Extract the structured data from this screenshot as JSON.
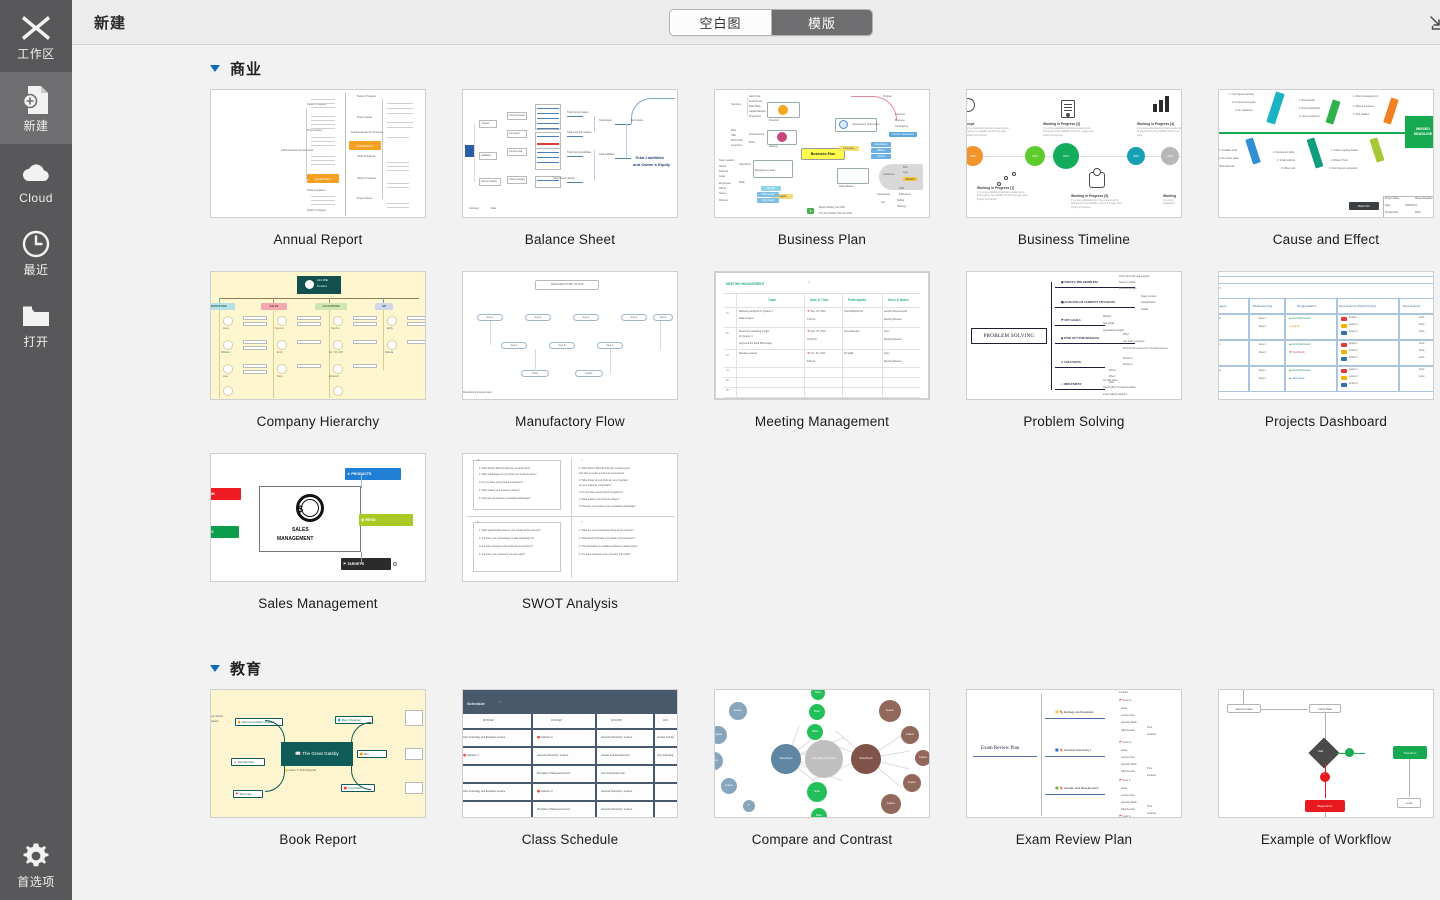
{
  "sidebar": {
    "items": [
      {
        "label": "工作区",
        "icon": "workspace-icon",
        "active": false
      },
      {
        "label": "新建",
        "icon": "new-document-icon",
        "active": true
      },
      {
        "label": "Cloud",
        "icon": "cloud-icon",
        "active": false
      },
      {
        "label": "最近",
        "icon": "clock-icon",
        "active": false
      },
      {
        "label": "打开",
        "icon": "folder-icon",
        "active": false
      }
    ],
    "bottom": {
      "label": "首选项",
      "icon": "gear-icon"
    },
    "background": "#58585a",
    "active_background": "#6e6e70"
  },
  "header": {
    "title": "新建",
    "segmented": {
      "options": [
        {
          "label": "空白图",
          "selected": false
        },
        {
          "label": "模版",
          "selected": true
        }
      ]
    },
    "import_icon": "import-download-icon"
  },
  "sections": [
    {
      "title": "商业",
      "expanded": true,
      "templates": [
        {
          "name": "Annual Report",
          "thumb": "annual-report"
        },
        {
          "name": "Balance Sheet",
          "thumb": "balance-sheet"
        },
        {
          "name": "Business Plan",
          "thumb": "business-plan"
        },
        {
          "name": "Business Timeline",
          "thumb": "business-timeline"
        },
        {
          "name": "Cause and Effect",
          "thumb": "cause-and-effect"
        },
        {
          "name": "Company Hierarchy",
          "thumb": "company-hierarchy"
        },
        {
          "name": "Manufactory Flow",
          "thumb": "manufactory-flow"
        },
        {
          "name": "Meeting Management",
          "thumb": "meeting-management"
        },
        {
          "name": "Problem Solving",
          "thumb": "problem-solving"
        },
        {
          "name": "Projects Dashboard",
          "thumb": "projects-dashboard"
        },
        {
          "name": "Sales Management",
          "thumb": "sales-management"
        },
        {
          "name": "SWOT Analysis",
          "thumb": "swot-analysis"
        }
      ]
    },
    {
      "title": "教育",
      "expanded": true,
      "templates": [
        {
          "name": "Book Report",
          "thumb": "book-report"
        },
        {
          "name": "Class Schedule",
          "thumb": "class-schedule"
        },
        {
          "name": "Compare and Contrast",
          "thumb": "compare-and-contrast"
        },
        {
          "name": "Exam Review Plan",
          "thumb": "exam-review-plan"
        },
        {
          "name": "Example of Workflow",
          "thumb": "example-of-workflow"
        }
      ]
    }
  ],
  "thumbnails": {
    "annual_report": {
      "badges": [
        "QUARTER 2",
        "QUARTER 1"
      ],
      "groups": [
        "Tasks in Progress",
        "Project Issues",
        "Self Assessment & Comments",
        "Tasks Completed"
      ],
      "accent": "#f5a020"
    },
    "balance_sheet": {
      "root": "",
      "branches": [
        "Assets",
        "Liabilities",
        "Owner's Equity"
      ],
      "leaves": [
        "Total Current Assets",
        "Total Long-term Assets",
        "Total Current Liabilities",
        "Total Assets",
        "Total Liabilities",
        "Total Owner's Equity"
      ],
      "callout": "Total Liabilities and Owner's Equity",
      "accent": "#2a5fa8"
    },
    "business_plan": {
      "center": "Business Plan",
      "nodes": [
        "Financial",
        "Strategy",
        "Management Team",
        "Product",
        "Executive Summary",
        "Company",
        "Target Market"
      ],
      "center_fill": "#ffff4d"
    },
    "business_timeline": {
      "milestones": [
        {
          "year": "2012",
          "color": "#f0952a",
          "title": "Concept"
        },
        {
          "year": "2013",
          "color": "#5ecc2b",
          "title": "Working in Progress [1]"
        },
        {
          "year": "2014",
          "color": "#13ab5c",
          "title": "Working in Progress [2]"
        },
        {
          "year": "2015",
          "color": "#18a0b4",
          "title": "Working in Progress [3]"
        },
        {
          "year": "2016",
          "color": "#b7b7b7",
          "title": "Working in Progress [4]"
        }
      ],
      "body": "It is a long established fact that a reader will be distracted by the readable content of a page when looking at its layout."
    },
    "cause_and_effect": {
      "head": "MISSED DEADLINE",
      "bones": [
        {
          "label": "Machine",
          "color": "#19b3c4"
        },
        {
          "label": "Method",
          "color": "#2fb24c"
        },
        {
          "label": "Material",
          "color": "#f38020"
        },
        {
          "label": "Measurement",
          "color": "#2e8fd4"
        },
        {
          "label": "Manpower",
          "color": "#0e9e7e"
        },
        {
          "label": "Mother Nature",
          "color": "#a6c832"
        }
      ],
      "footer_button": "Basic Info",
      "footer_fields": [
        "Project Name",
        "Date",
        "Prepared By"
      ],
      "footer_values": [
        "Missed Deadline",
        "2018/09/19",
        "Molly"
      ],
      "spine_color": "#16a94f"
    },
    "company_hierarchy": {
      "ceo": {
        "name": "John DOE",
        "role": "President"
      },
      "departments": [
        {
          "label": "MARKETING",
          "color": "#b6e2e6"
        },
        {
          "label": "SALES",
          "color": "#f4a9b0"
        },
        {
          "label": "ACCOUNTING",
          "color": "#cfe6b0"
        },
        {
          "label": "HR",
          "color": "#cfd8e8"
        }
      ],
      "background": "#fdf6cf"
    },
    "manufactory_flow": {
      "title": "MANUFACTORY FLOW"
    },
    "meeting_management": {
      "title": "MEETING MANAGEMENT",
      "columns": [
        "",
        "Topic",
        "Date & Time",
        "Participants",
        "Docs & Notes"
      ],
      "rows": [
        {
          "no": "01",
          "topic": "Marketing analysis for Quarter 3 / Data Analysis",
          "date": "Sep. 15, 2018",
          "time": "3:00 pm",
          "participants": "Owen/Molly/Anna",
          "notes": "sample document.pdf / Meeting Minutes"
        },
        {
          "no": "02",
          "topic": "Determine  marketing budget for Quarter 4 / Approved the $100,000 budget",
          "date": "Sep. 30, 2018",
          "time": "10:00 am",
          "participants": "Owen/Stephen",
          "notes": "Docs / Meeting Minutes"
        },
        {
          "no": "03",
          "topic": "Release meeting",
          "date": "Oct. 30, 2018",
          "time": "9:00 am",
          "participants": "All Staffs",
          "notes": "Docs / Meeting Minutes"
        },
        {
          "no": "04",
          "topic": "",
          "date": "",
          "time": "",
          "participants": "",
          "notes": ""
        },
        {
          "no": "05",
          "topic": "",
          "date": "",
          "time": "",
          "participants": "",
          "notes": ""
        },
        {
          "no": "06",
          "topic": "",
          "date": "",
          "time": "",
          "participants": "",
          "notes": ""
        }
      ],
      "accent": "#2fae8e"
    },
    "problem_solving": {
      "center": "PROBLEM SOLVING",
      "branches": [
        "WHAT'S THE PROBLEM",
        "ANALYSIS OF CURRENT SITUATION",
        "SET GOALS",
        "FIND OUT THE REASONS",
        "SOLUTIONS",
        "IMPLEMENT"
      ]
    },
    "projects_dashboard": {
      "columns": [
        "Project Manager",
        "Brainstorming",
        "Progress/ECT",
        "Next Actions (High Priority)",
        "Next Actions"
      ],
      "rows": [
        {
          "manager": "Frank",
          "ideas": [
            "Idea 1",
            "Idea 2"
          ],
          "progress": [
            "Accomplishments",
            "Aug 30"
          ],
          "actions": [
            "Action 1",
            "Action 2",
            "Action 3"
          ]
        },
        {
          "manager": "Owen",
          "ideas": [
            "Idea 1",
            "Idea 2"
          ],
          "progress": [
            "Accomplishments",
            "Next Month"
          ],
          "actions": [
            "Action 1",
            "Action 2",
            "Action 3"
          ]
        },
        {
          "manager": "Vivian",
          "ideas": [
            "Idea 1",
            "Idea 2"
          ],
          "progress": [
            "Accomplishments",
            "I don't know"
          ],
          "actions": [
            "Action 1",
            "Action 2",
            "Action 3"
          ]
        }
      ],
      "accent": "#3b6fa8"
    },
    "sales_management": {
      "center": "SALES MANAGEMENT",
      "chips": [
        {
          "label": "CRM",
          "color": "#ee1c22"
        },
        {
          "label": "ANALYSIS",
          "color": "#0a9e4a"
        },
        {
          "label": "PRODUCTS",
          "color": "#1f7fd4"
        },
        {
          "label": "RESOURCES",
          "color": "#a9ca22"
        },
        {
          "label": "TARGETS",
          "color": "#2b2b2b"
        }
      ]
    },
    "swot_analysis": {
      "quadrants": [
        "S",
        "W",
        "O",
        "T"
      ]
    },
    "book_report": {
      "center": "The Great Gatsby",
      "subtitle": "Author: F. Scott Fitzgerald",
      "nodes": [
        "Main Character",
        "Plot",
        "Conclusion",
        "Summary",
        "Favorite Part",
        "Recommendation Reason"
      ],
      "background": "#fcf5d0",
      "accent": "#0e5b57"
    },
    "class_schedule": {
      "title": "Schedule",
      "times": [
        "08:30 AM",
        "10:00 AM",
        "02:00 PM",
        "04:00 PM"
      ],
      "classes": [
        [
          "Intro to Ecology and Evolution Lecture",
          "Calculus II",
          "General Chemistry I Lecture",
          "Gender and Development"
        ],
        [
          "Calculus II",
          "General Chemistry I Lecture",
          "Gender and Development",
          "Intro to Ecology and Evolution Lecture"
        ],
        [
          "",
          "Principles of Macroeconomics",
          "Intro to Evolution Lab",
          ""
        ],
        [
          "Intro to Ecology and Evolution Lecture",
          "Calculus II",
          "General Chemistry I Lecture",
          ""
        ],
        [
          "",
          "Principles of Macroeconomics",
          "General Chemistry I Lecture",
          ""
        ]
      ],
      "background": "#47596a"
    },
    "compare_and_contrast": {
      "left": "Something A",
      "right": "Something B",
      "middle": "Something In Common",
      "left_color": "#7b9cb5",
      "right_color": "#8b5f52",
      "middle_color": "#23c05a"
    },
    "exam_review_plan": {
      "title": "Exam Review Plan",
      "subjects": [
        "Ecology and Evolution",
        "General Chemistry I",
        "Gender and Development"
      ],
      "items": [
        "Goal: A+",
        "Essay",
        "Lecture Note",
        "Question Bank",
        "Q&A Session",
        "Time",
        "Location"
      ]
    },
    "example_of_workflow": {
      "nodes": [
        "Receive Data",
        "Verify Data",
        "Valid",
        "Transform",
        "Reject Error",
        "Load"
      ],
      "yes_color": "#16a94f",
      "no_color": "#e8181f"
    }
  }
}
